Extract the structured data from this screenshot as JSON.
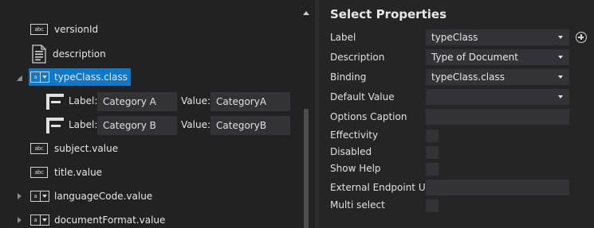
{
  "tree": {
    "items": [
      {
        "label": "versionId",
        "icon": "text-field-icon"
      },
      {
        "label": "description",
        "icon": "document-icon"
      },
      {
        "label": "typeClass.class",
        "icon": "select-field-icon",
        "selected": true
      },
      {
        "label": "subject.value",
        "icon": "text-field-icon"
      },
      {
        "label": "title.value",
        "icon": "text-field-icon"
      },
      {
        "label": "languageCode.value",
        "icon": "select-field-icon"
      },
      {
        "label": "documentFormat.value",
        "icon": "select-field-icon"
      }
    ],
    "options": [
      {
        "label_caption": "Label:",
        "label_value": "Category A",
        "value_caption": "Value:",
        "value_value": "CategoryA"
      },
      {
        "label_caption": "Label:",
        "label_value": "Category B",
        "value_caption": "Value:",
        "value_value": "CategoryB"
      }
    ],
    "icon_text_abc": "abc"
  },
  "properties": {
    "title": "Select Properties",
    "label": {
      "caption": "Label",
      "value": "typeClass"
    },
    "description": {
      "caption": "Description",
      "value": "Type of Document"
    },
    "binding": {
      "caption": "Binding",
      "value": "typeClass.class"
    },
    "default_value": {
      "caption": "Default Value",
      "value": ""
    },
    "options_caption": {
      "caption": "Options Caption",
      "value": ""
    },
    "effectivity": {
      "caption": "Effectivity"
    },
    "disabled": {
      "caption": "Disabled"
    },
    "show_help": {
      "caption": "Show Help"
    },
    "external_endpoint_url": {
      "caption": "External Endpoint URL",
      "value": ""
    },
    "multi_select": {
      "caption": "Multi select"
    }
  },
  "colors": {
    "selection": "#0e78c9",
    "field_background": "#333337",
    "pane_background": "#252526"
  }
}
